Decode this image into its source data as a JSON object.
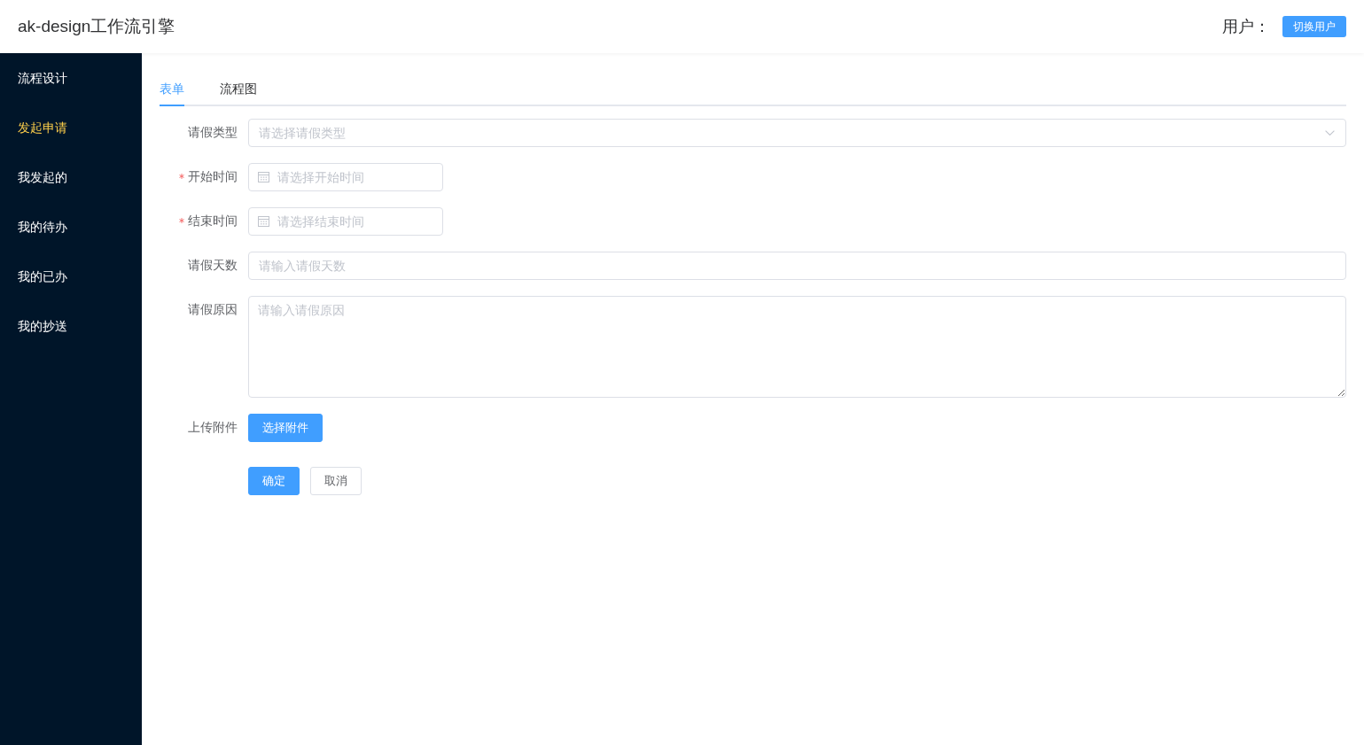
{
  "header": {
    "title": "ak-design工作流引擎",
    "user_label": "用户：",
    "switch_button": "切换用户"
  },
  "sidebar": {
    "items": [
      {
        "label": "流程设计",
        "selected": false
      },
      {
        "label": "发起申请",
        "selected": true
      },
      {
        "label": "我发起的",
        "selected": false
      },
      {
        "label": "我的待办",
        "selected": false
      },
      {
        "label": "我的已办",
        "selected": false
      },
      {
        "label": "我的抄送",
        "selected": false
      }
    ]
  },
  "tabs": [
    {
      "label": "表单",
      "selected": true
    },
    {
      "label": "流程图",
      "selected": false
    }
  ],
  "form": {
    "fields": [
      {
        "kind": "select",
        "label": "请假类型",
        "required": false,
        "placeholder": "请选择请假类型"
      },
      {
        "kind": "date",
        "label": "开始时间",
        "required": true,
        "placeholder": "请选择开始时间"
      },
      {
        "kind": "date",
        "label": "结束时间",
        "required": true,
        "placeholder": "请选择结束时间"
      },
      {
        "kind": "input",
        "label": "请假天数",
        "required": false,
        "placeholder": "请输入请假天数"
      },
      {
        "kind": "textarea",
        "label": "请假原因",
        "required": false,
        "placeholder": "请输入请假原因"
      },
      {
        "kind": "upload",
        "label": "上传附件",
        "required": false,
        "button": "选择附件"
      }
    ],
    "actions": [
      {
        "kind": "primary",
        "label": "确定"
      },
      {
        "kind": "default",
        "label": "取消"
      }
    ]
  }
}
